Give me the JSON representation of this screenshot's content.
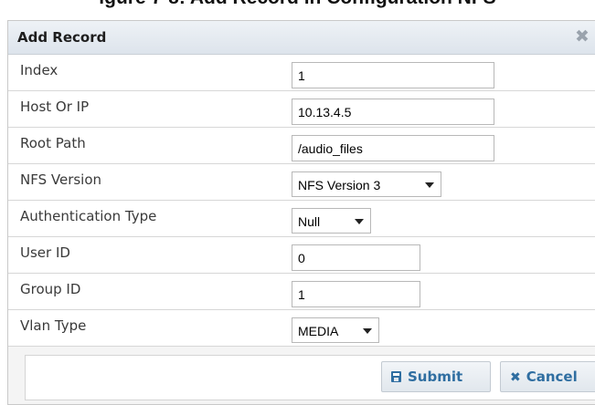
{
  "figure_caption": "igure 7-8: Add Record in Configuration NFS",
  "dialog": {
    "title": "Add Record",
    "close_icon": "close-icon"
  },
  "fields": [
    {
      "label": "Index",
      "type": "input",
      "value": "1"
    },
    {
      "label": "Host Or IP",
      "type": "input",
      "value": "10.13.4.5"
    },
    {
      "label": "Root Path",
      "type": "input",
      "value": "/audio_files"
    },
    {
      "label": "NFS Version",
      "type": "select",
      "value": "NFS Version 3"
    },
    {
      "label": "Authentication Type",
      "type": "select",
      "value": "Null"
    },
    {
      "label": "User ID",
      "type": "input",
      "value": "0"
    },
    {
      "label": "Group ID",
      "type": "input",
      "value": "1"
    },
    {
      "label": "Vlan Type",
      "type": "select",
      "value": "MEDIA"
    }
  ],
  "buttons": {
    "submit_label": "Submit",
    "cancel_label": "Cancel",
    "submit_icon": "save-icon",
    "cancel_icon": "x-icon"
  },
  "colors": {
    "button_text": "#2f6ea1",
    "titlebar": "#e4e9ef"
  }
}
